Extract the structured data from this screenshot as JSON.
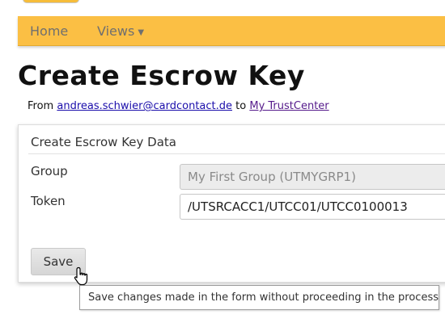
{
  "nav": {
    "home_label": "Home",
    "views_label": "Views",
    "views_caret": "▼"
  },
  "page": {
    "title": "Create Escrow Key"
  },
  "breadcrumb": {
    "from_text": "From",
    "user_link": "andreas.schwier@cardcontact.de",
    "to_text": "to",
    "trustcenter_link": "My TrustCenter"
  },
  "form": {
    "panel_title": "Create Escrow Key Data",
    "group_label": "Group",
    "group_value": "My First Group (UTMYGRP1)",
    "token_label": "Token",
    "token_value": "/UTSRCACC1/UTCC01/UTCC0100013",
    "save_label": "Save"
  },
  "tooltip": {
    "text": "Save changes made in the form without proceeding in the process"
  },
  "colors": {
    "navbar_background": "#fbbf44",
    "link_user": "#1a0dab",
    "link_trustcenter": "#551a8b"
  },
  "icons": {
    "cursor": "hand-pointer-cursor-icon"
  }
}
